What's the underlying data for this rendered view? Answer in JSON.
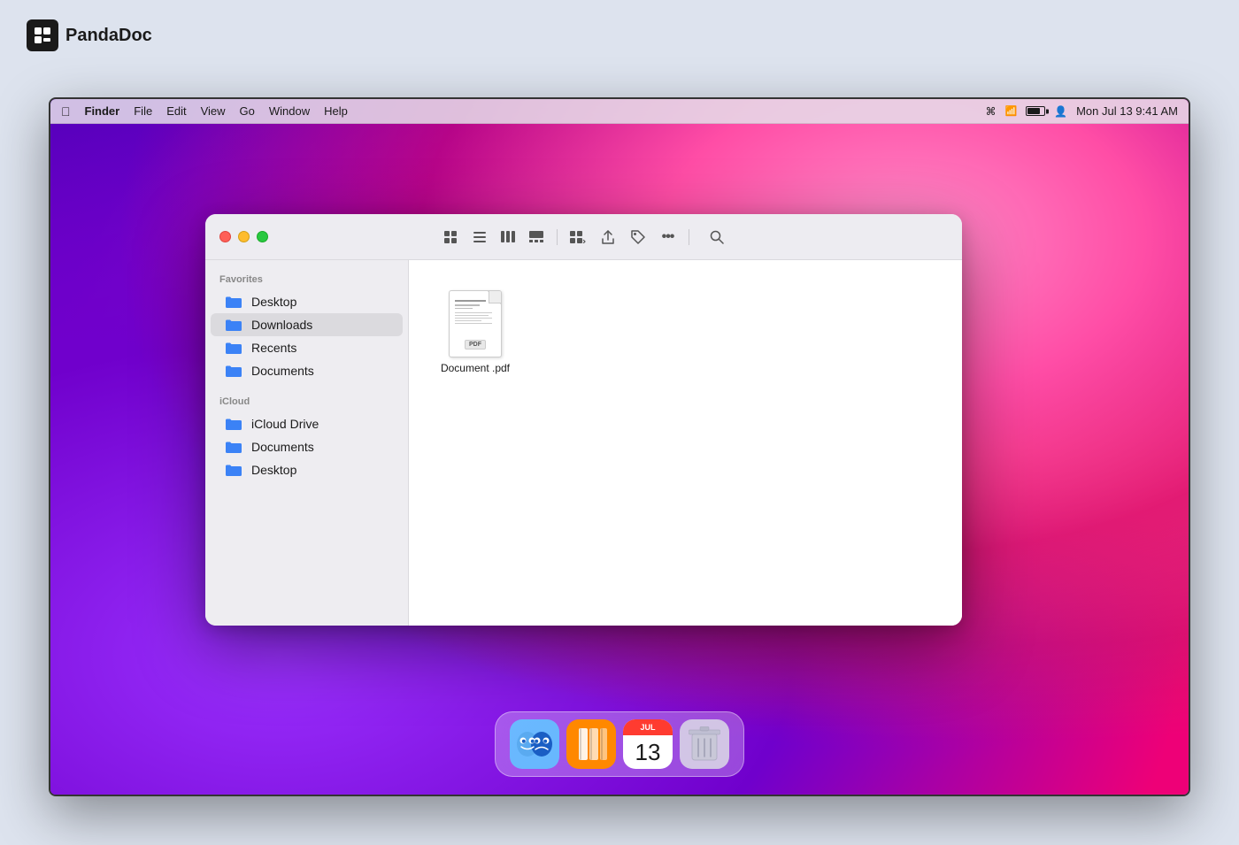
{
  "logo": {
    "icon_text": "pd",
    "name": "PandaDoc"
  },
  "menubar": {
    "apple": "🍎",
    "items": [
      {
        "label": "Finder",
        "bold": true
      },
      {
        "label": "File"
      },
      {
        "label": "Edit"
      },
      {
        "label": "View"
      },
      {
        "label": "Go"
      },
      {
        "label": "Window"
      },
      {
        "label": "Help"
      }
    ],
    "right": {
      "datetime": "Mon Jul 13  9:41 AM"
    }
  },
  "finder": {
    "sidebar": {
      "favorites_label": "Favorites",
      "favorites": [
        {
          "label": "Desktop"
        },
        {
          "label": "Downloads"
        },
        {
          "label": "Recents"
        },
        {
          "label": "Documents"
        }
      ],
      "icloud_label": "iCloud",
      "icloud": [
        {
          "label": "iCloud Drive"
        },
        {
          "label": "Documents"
        },
        {
          "label": "Desktop"
        }
      ]
    },
    "toolbar_icons": [
      {
        "icon": "⊞",
        "name": "grid-view"
      },
      {
        "icon": "≡",
        "name": "list-view"
      },
      {
        "icon": "⫶",
        "name": "column-view"
      },
      {
        "icon": "⊟",
        "name": "gallery-view"
      },
      {
        "icon": "⊞▾",
        "name": "group-by"
      },
      {
        "icon": "↑",
        "name": "share"
      },
      {
        "icon": "◇",
        "name": "tag"
      },
      {
        "icon": "•••",
        "name": "more"
      },
      {
        "icon": "🔍",
        "name": "search"
      }
    ],
    "file": {
      "name": "Document .pdf",
      "pdf_label": "PDF"
    }
  },
  "dock": {
    "items": [
      {
        "name": "finder",
        "label": "Finder"
      },
      {
        "name": "books",
        "label": "Books"
      },
      {
        "name": "calendar",
        "label": "Calendar",
        "month": "JUL",
        "day": "13"
      },
      {
        "name": "trash",
        "label": "Trash"
      }
    ]
  }
}
